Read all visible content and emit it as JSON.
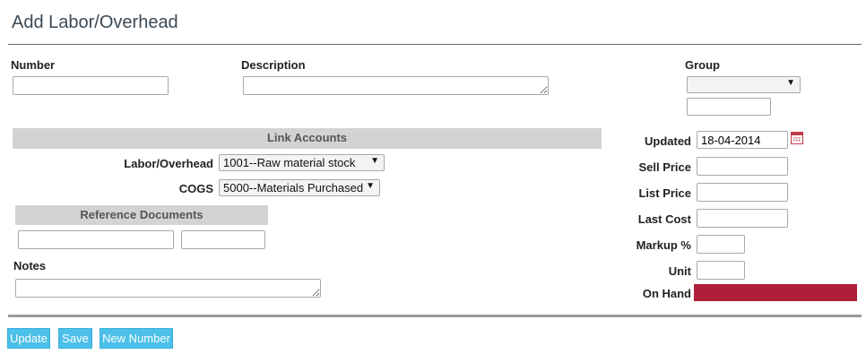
{
  "page": {
    "title": "Add Labor/Overhead"
  },
  "fields": {
    "number_label": "Number",
    "number_value": "",
    "description_label": "Description",
    "description_value": "",
    "group_label": "Group",
    "group_selected": "",
    "group_extra_value": ""
  },
  "link_accounts": {
    "header": "Link Accounts",
    "labor_overhead_label": "Labor/Overhead",
    "labor_overhead_value": "1001--Raw material stock",
    "cogs_label": "COGS",
    "cogs_value": "5000--Materials Purchased"
  },
  "reference_documents": {
    "header": "Reference Documents",
    "ref1_value": "",
    "ref2_value": ""
  },
  "notes": {
    "label": "Notes",
    "value": ""
  },
  "pricing": {
    "updated_label": "Updated",
    "updated_value": "18-04-2014",
    "sell_price_label": "Sell Price",
    "sell_price_value": "",
    "list_price_label": "List Price",
    "list_price_value": "",
    "last_cost_label": "Last Cost",
    "last_cost_value": "",
    "markup_label": "Markup %",
    "markup_value": "",
    "unit_label": "Unit",
    "unit_value": "",
    "on_hand_label": "On Hand",
    "on_hand_color": "#b01e3a"
  },
  "buttons": {
    "update": "Update",
    "save": "Save",
    "new_number": "New Number",
    "color": "#4cc0e8"
  },
  "icons": {
    "caret": "▼",
    "calendar": "calendar-icon"
  }
}
